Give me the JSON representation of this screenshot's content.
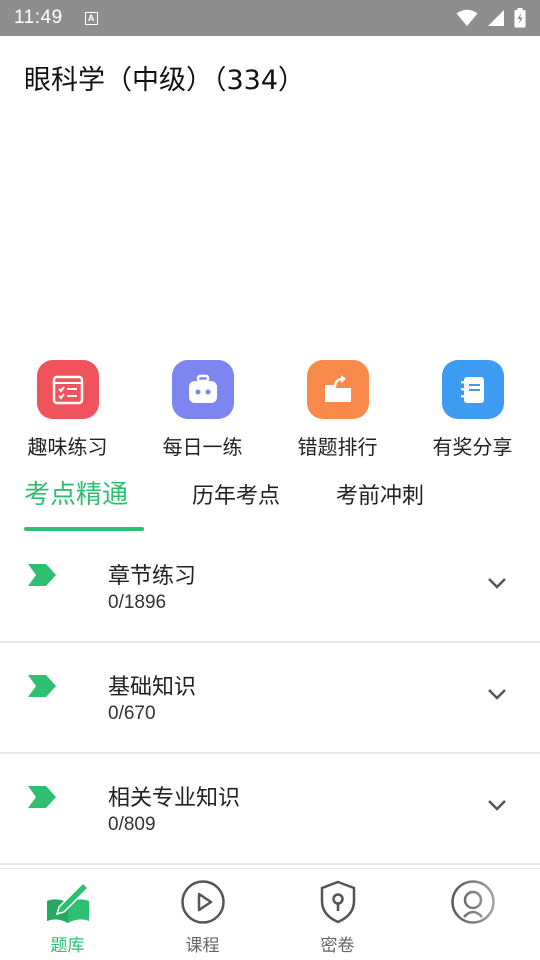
{
  "status_bar": {
    "time": "11:49",
    "notification_badge": "A",
    "icons": [
      "wifi-icon",
      "signal-icon",
      "battery-icon"
    ]
  },
  "page": {
    "title": "眼科学（中级）（334）"
  },
  "actions": [
    {
      "label": "趣味练习",
      "icon": "checklist-icon",
      "color": "#f0535b"
    },
    {
      "label": "每日一练",
      "icon": "robot-icon",
      "color": "#7d86f0"
    },
    {
      "label": "错题排行",
      "icon": "folder-share-icon",
      "color": "#f98a4b"
    },
    {
      "label": "有奖分享",
      "icon": "notebook-icon",
      "color": "#3d9cf2"
    }
  ],
  "tabs": [
    {
      "label": "考点精通",
      "active": true
    },
    {
      "label": "历年考点",
      "active": false
    },
    {
      "label": "考前冲刺",
      "active": false
    }
  ],
  "list": [
    {
      "title": "章节练习",
      "progress": "0/1896"
    },
    {
      "title": "基础知识",
      "progress": "0/670"
    },
    {
      "title": "相关专业知识",
      "progress": "0/809"
    }
  ],
  "bottom_nav": [
    {
      "label": "题库",
      "icon": "book-pen-icon",
      "active": true
    },
    {
      "label": "课程",
      "icon": "play-icon",
      "active": false
    },
    {
      "label": "密卷",
      "icon": "lock-shield-icon",
      "active": false
    },
    {
      "label": "",
      "icon": "profile-icon",
      "active": false
    }
  ],
  "colors": {
    "accent": "#2fbf71",
    "status_bar": "#8e8e8e"
  }
}
